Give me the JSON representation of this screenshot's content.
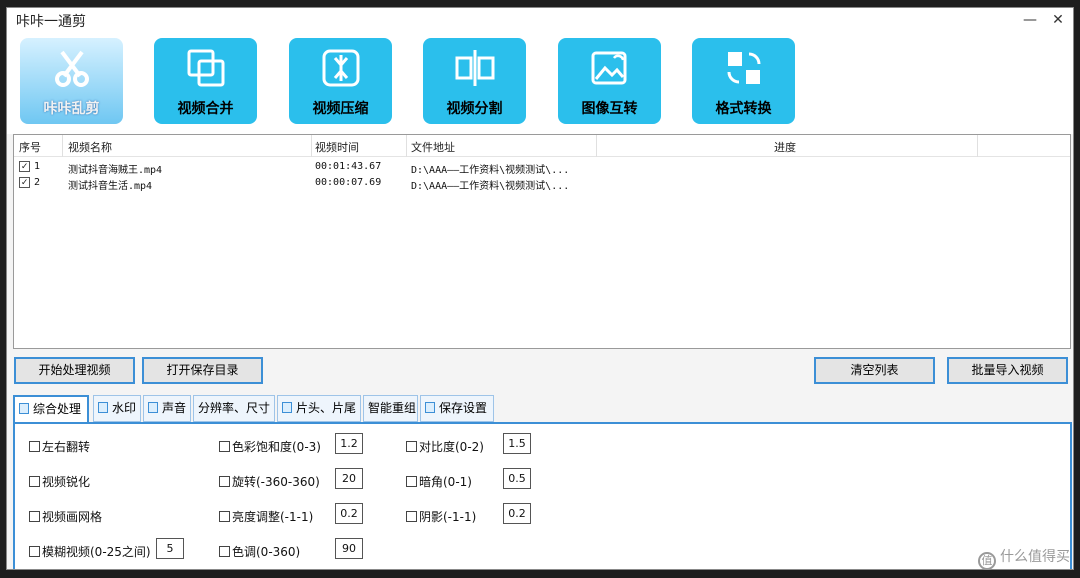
{
  "window": {
    "title": "咔咔一通剪",
    "minimize": "—",
    "close": "✕"
  },
  "toolbar": {
    "items": [
      {
        "label": "咔咔乱剪",
        "icon": "scissors-icon"
      },
      {
        "label": "视频合并",
        "icon": "merge-icon"
      },
      {
        "label": "视频压缩",
        "icon": "compress-icon"
      },
      {
        "label": "视频分割",
        "icon": "split-icon"
      },
      {
        "label": "图像互转",
        "icon": "image-convert-icon"
      },
      {
        "label": "格式转换",
        "icon": "format-convert-icon"
      }
    ]
  },
  "grid": {
    "columns": [
      "序号",
      "视频名称",
      "视频时间",
      "文件地址",
      "进度"
    ],
    "rows": [
      {
        "checked": true,
        "index": "1",
        "name": "测试抖音海贼王.mp4",
        "duration": "00:01:43.67",
        "path": "D:\\AAA——工作资料\\视频测试\\..."
      },
      {
        "checked": true,
        "index": "2",
        "name": "测试抖音生活.mp4",
        "duration": "00:00:07.69",
        "path": "D:\\AAA——工作资料\\视频测试\\..."
      }
    ]
  },
  "actions": {
    "start": "开始处理视频",
    "open_dir": "打开保存目录",
    "clear": "清空列表",
    "import": "批量导入视频"
  },
  "tabs": [
    "综合处理",
    "水印",
    "声音",
    "分辨率、尺寸",
    "片头、片尾",
    "智能重组",
    "保存设置"
  ],
  "options": {
    "flip": "左右翻转",
    "sharpen": "视频锐化",
    "grid": "视频画网格",
    "blur": "模糊视频(0-25之间)",
    "blur_val": "5",
    "saturation": "色彩饱和度(0-3)",
    "saturation_val": "1.2",
    "rotate": "旋转(-360-360)",
    "rotate_val": "20",
    "brightness": "亮度调整(-1-1)",
    "brightness_val": "0.2",
    "hue": "色调(0-360)",
    "hue_val": "90",
    "contrast": "对比度(0-2)",
    "contrast_val": "1.5",
    "vignette": "暗角(0-1)",
    "vignette_val": "0.5",
    "shadow": "阴影(-1-1)",
    "shadow_val": "0.2"
  },
  "watermark": {
    "text": "什么值得买",
    "logo": "值"
  }
}
